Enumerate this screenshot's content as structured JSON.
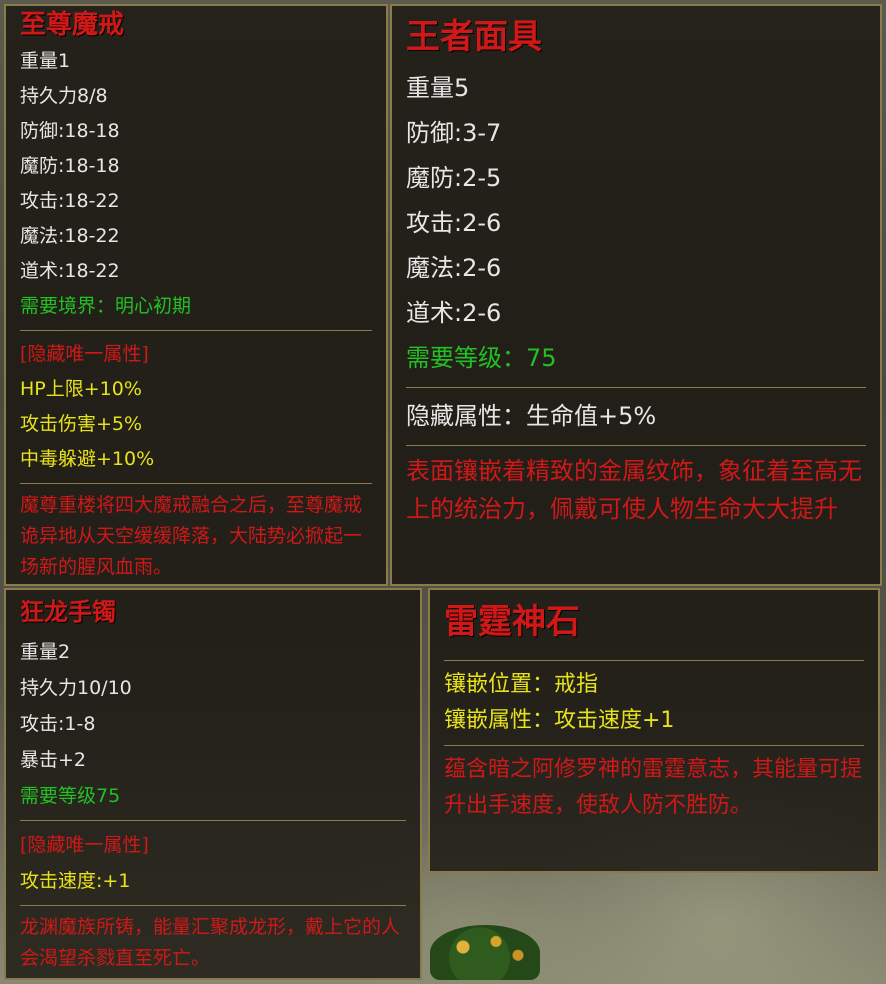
{
  "panels": {
    "ring": {
      "title": "至尊魔戒",
      "stats": [
        "重量1",
        "持久力8/8",
        "防御:18-18",
        "魔防:18-18",
        "攻击:18-22",
        "魔法:18-22",
        "道术:18-22"
      ],
      "requirement": "需要境界：明心初期",
      "hidden_header": "[隐藏唯一属性]",
      "hidden_attrs": [
        "HP上限+10%",
        "攻击伤害+5%",
        "中毒躲避+10%"
      ],
      "description": "魔尊重楼将四大魔戒融合之后，至尊魔戒诡异地从天空缓缓降落，大陆势必掀起一场新的腥风血雨。"
    },
    "mask": {
      "title": "王者面具",
      "stats": [
        "重量5",
        "防御:3-7",
        "魔防:2-5",
        "攻击:2-6",
        "魔法:2-6",
        "道术:2-6"
      ],
      "requirement": "需要等级：75",
      "hidden": "隐藏属性：生命值+5%",
      "description": "表面镶嵌着精致的金属纹饰，象征着至高无上的统治力，佩戴可使人物生命大大提升"
    },
    "bracelet": {
      "title": "狂龙手镯",
      "stats": [
        "重量2",
        "持久力10/10",
        "攻击:1-8",
        "暴击+2"
      ],
      "requirement": "需要等级75",
      "hidden_header": "[隐藏唯一属性]",
      "hidden_attrs": [
        "攻击速度:+1"
      ],
      "description": "龙渊魔族所铸，能量汇聚成龙形，戴上它的人会渴望杀戮直至死亡。"
    },
    "stone": {
      "title": "雷霆神石",
      "socket_position": "镶嵌位置：戒指",
      "socket_attr": "镶嵌属性：攻击速度+1",
      "description": "蕴含暗之阿修罗神的雷霆意志，其能量可提升出手速度，使敌人防不胜防。"
    }
  },
  "colors": {
    "title": "#d01818",
    "requirement": "#22c022",
    "hidden": "#e7e21a",
    "border": "#8a7a4c",
    "text": "#e6e6e6"
  }
}
